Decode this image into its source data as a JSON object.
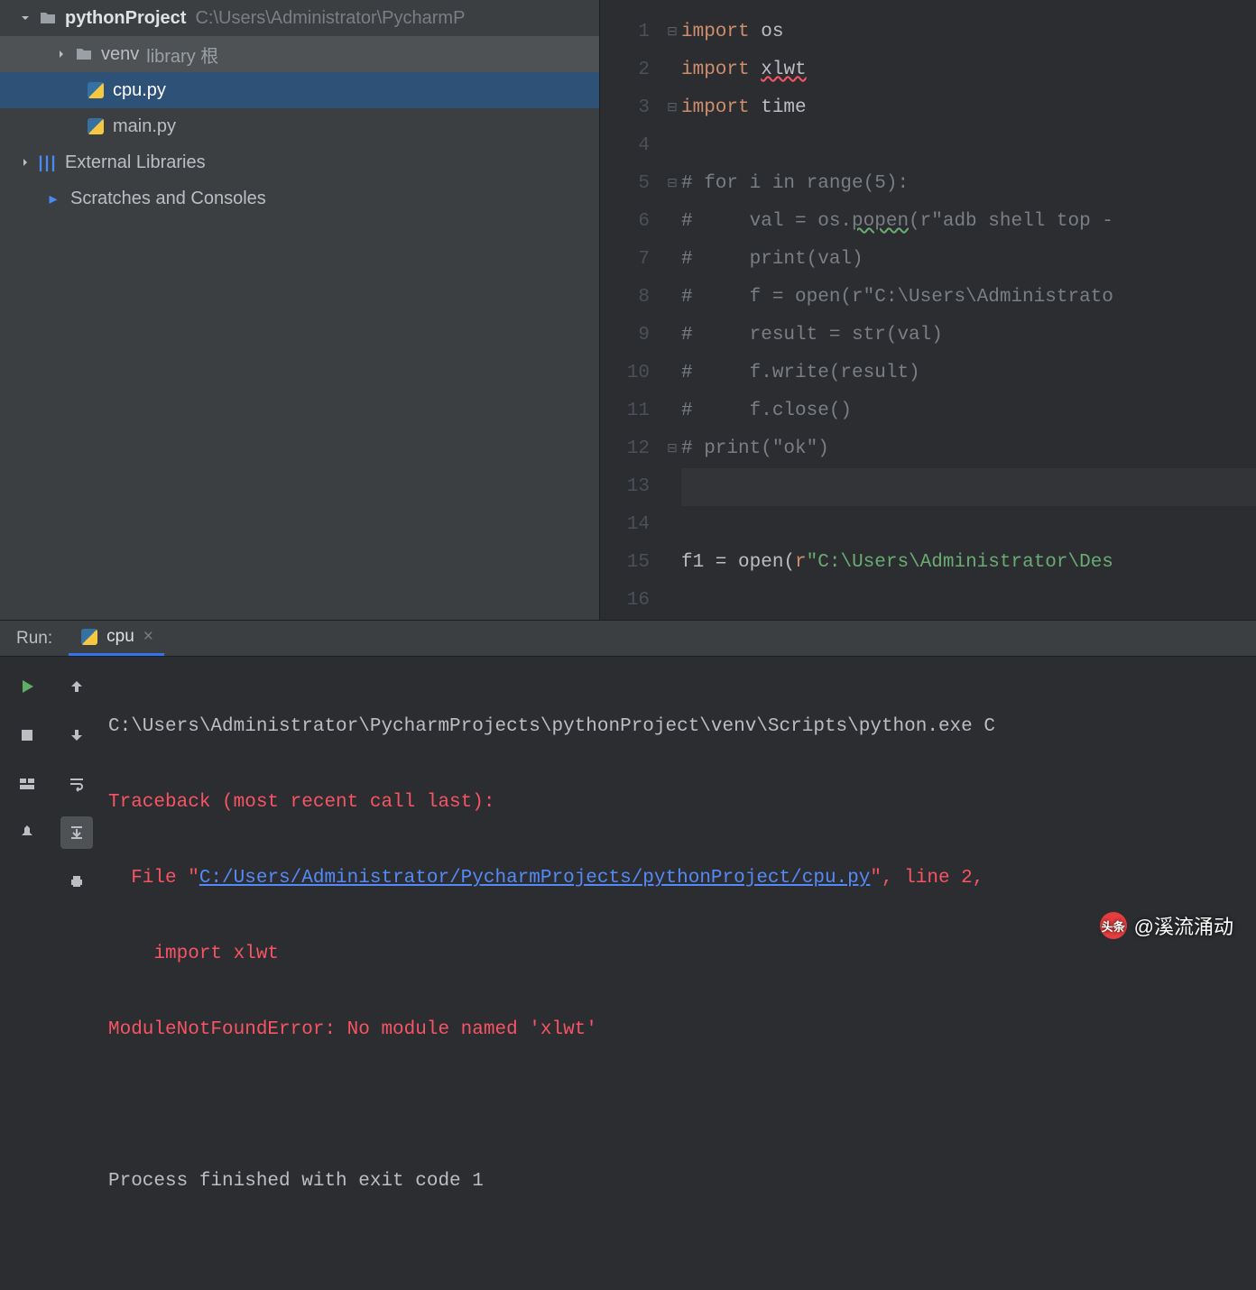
{
  "tree": {
    "root_name": "pythonProject",
    "root_path": "C:\\Users\\Administrator\\PycharmP",
    "venv_name": "venv",
    "venv_suffix": "library 根",
    "file_cpu": "cpu.py",
    "file_main": "main.py",
    "ext_lib": "External Libraries",
    "scratches": "Scratches and Consoles"
  },
  "editor": {
    "lines": [
      {
        "n": "1",
        "html": "<span class='kw'>import</span> os"
      },
      {
        "n": "2",
        "html": "<span class='kw'>import</span> <span class='err-underline'>xlwt</span>"
      },
      {
        "n": "3",
        "html": "<span class='kw'>import</span> time"
      },
      {
        "n": "4",
        "html": ""
      },
      {
        "n": "5",
        "html": "<span class='comment'># for i in range(5):</span>"
      },
      {
        "n": "6",
        "html": "<span class='comment'>#     val = os.</span><span class='comment warn-underline'>popen</span><span class='comment'>(r\"adb shell top -</span>"
      },
      {
        "n": "7",
        "html": "<span class='comment'>#     print(val)</span>"
      },
      {
        "n": "8",
        "html": "<span class='comment'>#     f = open(r\"C:\\Users\\Administrato</span>"
      },
      {
        "n": "9",
        "html": "<span class='comment'>#     result = str(val)</span>"
      },
      {
        "n": "10",
        "html": "<span class='comment'>#     f.write(result)</span>"
      },
      {
        "n": "11",
        "html": "<span class='comment'>#     f.close()</span>"
      },
      {
        "n": "12",
        "html": "<span class='comment'># print(\"ok\")</span>"
      },
      {
        "n": "13",
        "html": ""
      },
      {
        "n": "14",
        "html": ""
      },
      {
        "n": "15",
        "html": "f1 = <span class='fn'>open</span>(<span class='kw'>r</span><span class='str'>\"C:\\Users\\Administrator\\Des</span>"
      },
      {
        "n": "16",
        "html": ""
      }
    ]
  },
  "run": {
    "panel_label": "Run:",
    "tab_name": "cpu",
    "cmd": "C:\\Users\\Administrator\\PycharmProjects\\pythonProject\\venv\\Scripts\\python.exe C",
    "trace_header": "Traceback (most recent call last):",
    "trace_file_prefix": "  File \"",
    "trace_file_link": "C:/Users/Administrator/PycharmProjects/pythonProject/cpu.py",
    "trace_file_suffix": "\", line 2,",
    "trace_import": "    import xlwt",
    "trace_error": "ModuleNotFoundError: No module named 'xlwt'",
    "exit_msg": "Process finished with exit code 1"
  },
  "watermark": {
    "logo": "头条",
    "text": "@溪流涌动"
  }
}
